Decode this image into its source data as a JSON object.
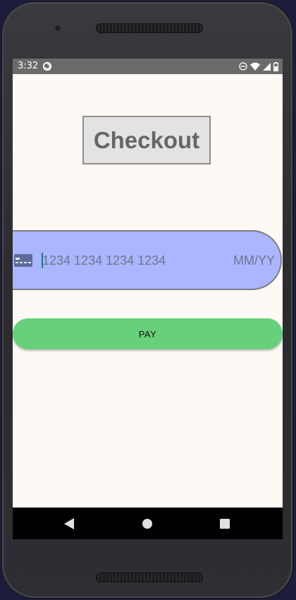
{
  "status_bar": {
    "time": "3:32",
    "icons": [
      "sync-icon",
      "do-not-disturb-icon",
      "wifi-icon",
      "cell-signal-icon",
      "battery-icon"
    ]
  },
  "checkout": {
    "title": "Checkout"
  },
  "card_form": {
    "card_icon": "credit-card-icon",
    "number_placeholder": "1234 1234 1234 1234",
    "expiry_placeholder": "MM/YY"
  },
  "pay": {
    "label": "PAY"
  },
  "nav_bar": {
    "icons": [
      "back-icon",
      "home-icon",
      "recents-icon"
    ]
  },
  "colors": {
    "screen_bg": "#fff9f5",
    "card_bg": "#aab6ff",
    "pay_bg": "#66d17a",
    "title_bg": "#e3e3e3",
    "status_bar_bg": "#6b6b6b"
  }
}
